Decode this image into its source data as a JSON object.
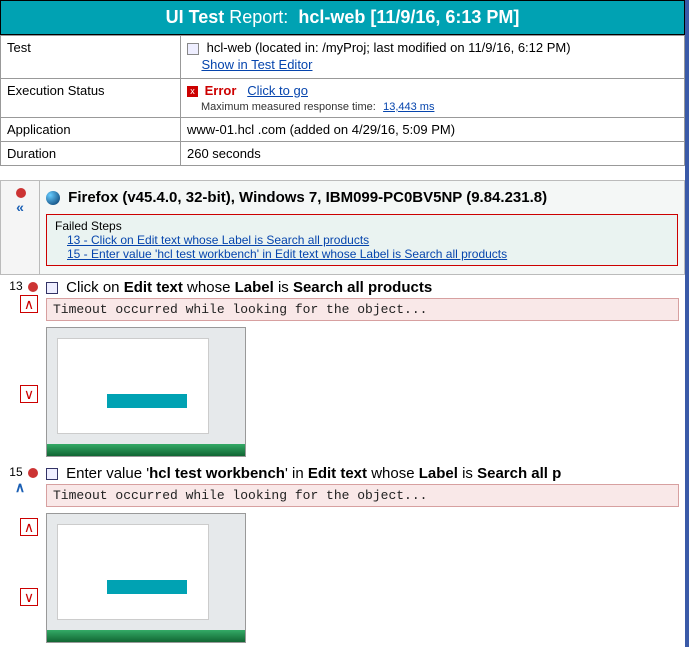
{
  "header": {
    "prefix_bold": "UI Test",
    "word_report": "Report:",
    "name": "hcl-web [11/9/16, 6:13 PM]"
  },
  "info": {
    "test_label": "Test",
    "test_value_main": "hcl-web (located in: /myProj; last modified on 11/9/16, 6:12 PM)",
    "test_link": "Show in Test Editor",
    "exec_label": "Execution Status",
    "exec_error": "Error",
    "exec_click": "Click to go",
    "exec_sub": "Maximum measured response time:",
    "exec_sub_link": "13,443 ms",
    "app_label": "Application",
    "app_value": "www-01.hcl .com (added on 4/29/16, 5:09 PM)",
    "dur_label": "Duration",
    "dur_value": "260 seconds"
  },
  "env": {
    "title": "Firefox (v45.4.0, 32-bit), Windows 7, IBM099-PC0BV5NP (9.84.231.8)",
    "failed_title": "Failed Steps",
    "failed_items": [
      "13 - Click on Edit text whose Label is Search all products",
      "15 - Enter value 'hcl test workbench' in Edit text whose Label is Search all products"
    ]
  },
  "steps": [
    {
      "num": "13",
      "title_pre": "Click on ",
      "title_b1": "Edit text",
      "title_mid": " whose ",
      "title_b2": "Label",
      "title_mid2": " is ",
      "title_b3": "Search all products",
      "timeout": "Timeout occurred while looking for the object..."
    },
    {
      "num": "15",
      "title_pre": "Enter value '",
      "title_b0": "hcl test workbench",
      "title_pre2": "' in ",
      "title_b1": "Edit text",
      "title_mid": " whose ",
      "title_b2": "Label",
      "title_mid2": " is ",
      "title_b3": "Search all p",
      "timeout": "Timeout occurred while looking for the object..."
    }
  ]
}
